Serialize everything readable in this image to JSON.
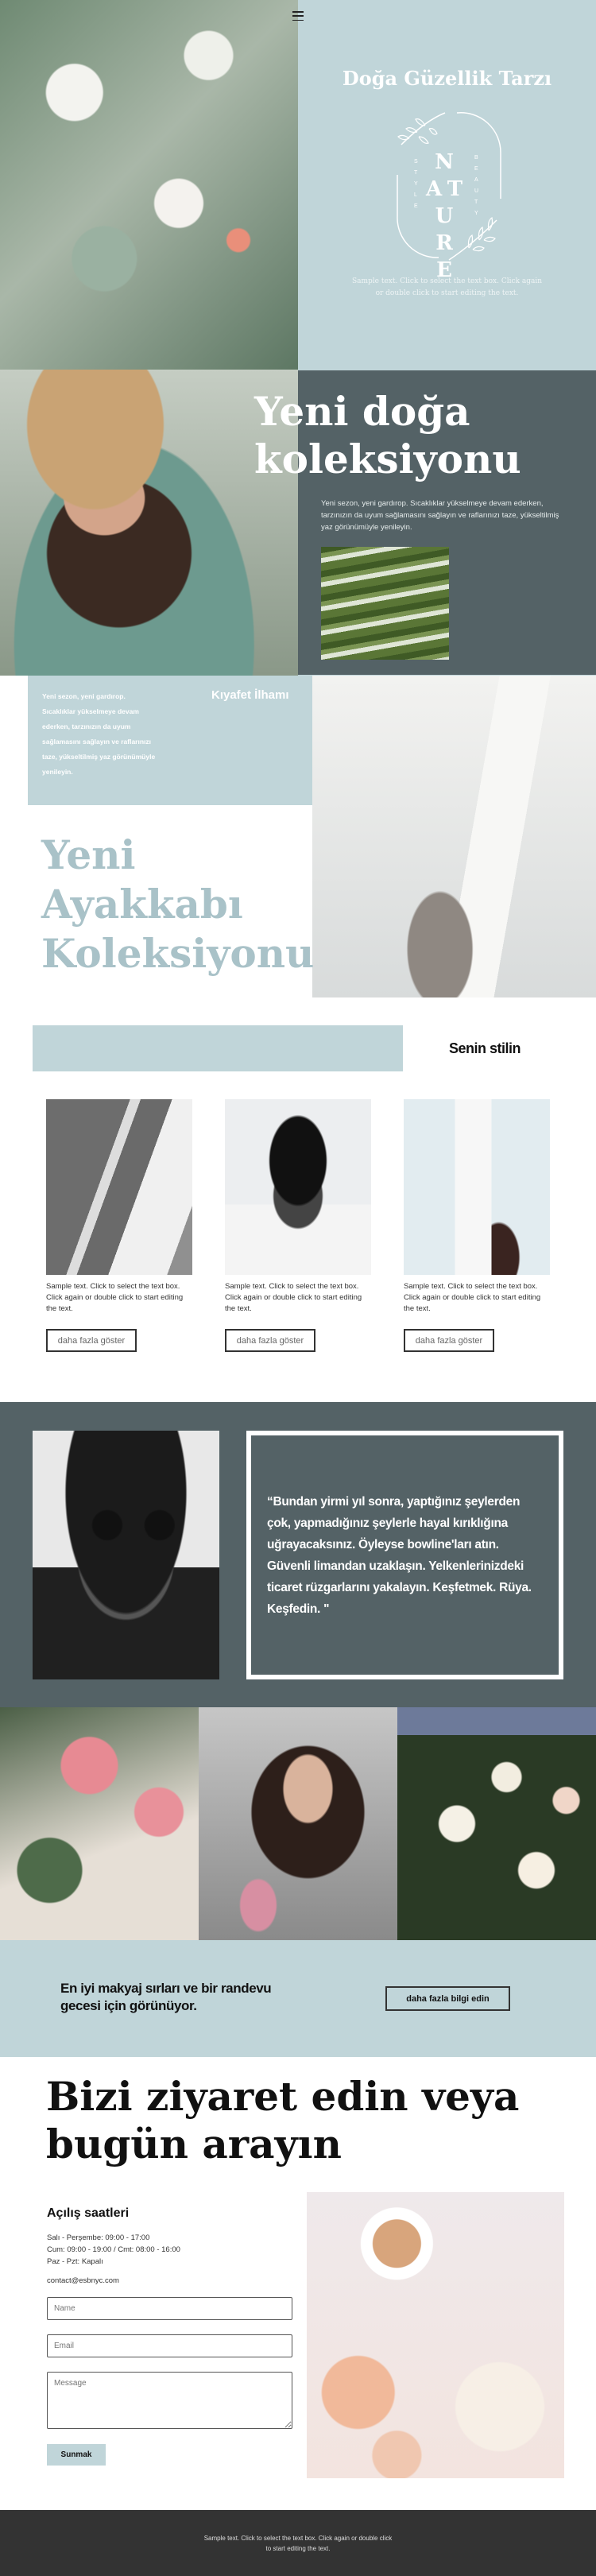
{
  "hero": {
    "title": "Doğa Güzellik Tarzı",
    "logo": {
      "main": "NATURE",
      "left": "STYLE",
      "right": "BEAUTY"
    },
    "text": "Sample text. Click to select the text box. Click again or double click to start editing the text.",
    "menu_icon": "hamburger-icon"
  },
  "collection": {
    "title_line1": "Yeni doğa",
    "title_line2": "koleksiyonu",
    "text": "Yeni sezon, yeni gardırop. Sıcaklıklar yükselmeye devam ederken, tarzınızın da uyum sağlamasını sağlayın ve raflarınızı taze, yükseltilmiş yaz görünümüyle yenileyin."
  },
  "shoes": {
    "label": "Kıyafet İlhamı",
    "text": "Yeni sezon, yeni gardırop. Sıcaklıklar yükselmeye devam ederken, tarzınızın da uyum sağlamasını sağlayın ve raflarınızı taze, yükseltilmiş yaz görünümüyle yenileyin.",
    "title_line1": "Yeni",
    "title_line2": "Ayakkabı",
    "title_line3": "Koleksiyonu"
  },
  "style": {
    "title": "Senin stilin",
    "cards": [
      {
        "text": "Sample text. Click to select the text box. Click again or double click to start editing the text.",
        "button": "daha fazla göster"
      },
      {
        "text": "Sample text. Click to select the text box. Click again or double click to start editing the text.",
        "button": "daha fazla göster"
      },
      {
        "text": "Sample text. Click to select the text box. Click again or double click to start editing the text.",
        "button": "daha fazla göster"
      }
    ]
  },
  "quote": {
    "text": "“Bundan yirmi yıl sonra, yaptığınız şeylerden çok, yapmadığınız şeylerle hayal kırıklığına uğrayacaksınız. Öyleyse bowline'ları atın. Güvenli limandan uzaklaşın. Yelkenlerinizdeki ticaret rüzgarlarını yakalayın. Keşfetmek. Rüya. Keşfedin. \""
  },
  "cta": {
    "text": "En iyi makyaj sırları ve bir randevu gecesi için görünüyor.",
    "button": "daha fazla bilgi edin"
  },
  "contact": {
    "title_line1": "Bizi ziyaret edin veya",
    "title_line2": "bugün arayın",
    "hours_title": "Açılış saatleri",
    "hours": [
      "Salı - Perşembe: 09:00 - 17:00",
      "Cum: 09:00 - 19:00 / Cmt: 08:00 - 16:00",
      "Paz - Pzt: Kapalı"
    ],
    "email": "contact@esbnyc.com",
    "form": {
      "name_placeholder": "Name",
      "email_placeholder": "Email",
      "message_placeholder": "Message",
      "submit": "Sunmak"
    }
  },
  "footer": {
    "text": "Sample text. Click to select the text box. Click again or double click to start editing the text."
  },
  "colors": {
    "light_blue": "#c0d5d9",
    "slate": "#546266",
    "heading_blue": "#a9c2c8",
    "footer": "#333333"
  }
}
